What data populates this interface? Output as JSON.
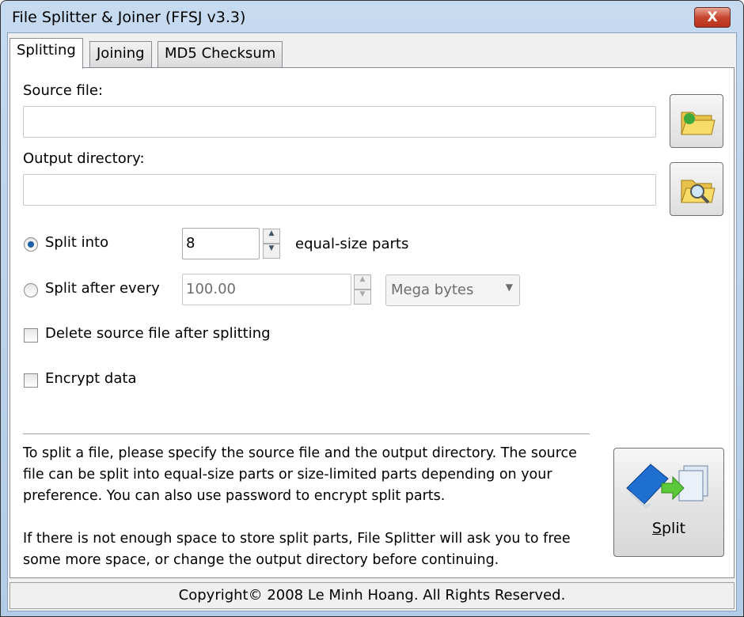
{
  "window": {
    "title": "File Splitter & Joiner (FFSJ v3.3)",
    "close_label": "X"
  },
  "tabs": [
    {
      "label": "Splitting",
      "active": true
    },
    {
      "label": "Joining"
    },
    {
      "label": "MD5 Checksum"
    }
  ],
  "source": {
    "label": "Source file:",
    "value": "",
    "icon": "folder-open-icon"
  },
  "output": {
    "label": "Output directory:",
    "value": "",
    "icon": "folder-search-icon"
  },
  "split_into": {
    "label": "Split into",
    "value": "8",
    "suffix": "equal-size parts",
    "selected": true
  },
  "split_every": {
    "label": "Split after every",
    "value": "100.00",
    "unit": "Mega bytes",
    "selected": false
  },
  "delete_source": {
    "label": "Delete source file after splitting",
    "checked": false
  },
  "encrypt": {
    "label": "Encrypt data",
    "checked": false
  },
  "info": {
    "p1": "To split a file, please specify the source file and the output directory. The source file can be split into equal-size parts or size-limited parts depending on your preference. You can also use password to encrypt split parts.",
    "p2": "If there is not enough space to store split parts, File Splitter will ask you to free some more space, or change the output directory before continuing."
  },
  "split_button": {
    "label_first": "S",
    "label_rest": "plit"
  },
  "status": "Copyright© 2008 Le Minh Hoang. All Rights Reserved."
}
